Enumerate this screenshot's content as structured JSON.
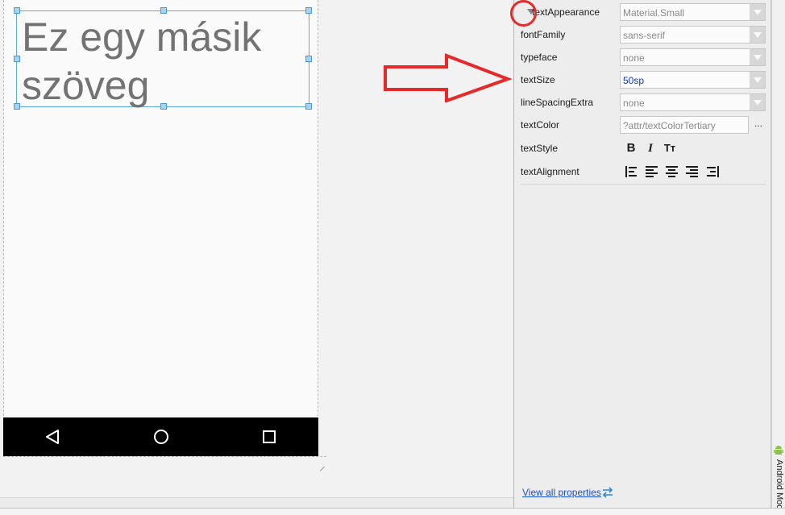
{
  "preview": {
    "text": "Ez egy másik\nszöveg"
  },
  "properties": {
    "rows": [
      {
        "label": "textAppearance",
        "value": "Material.Small",
        "kind": "dropdown"
      },
      {
        "label": "fontFamily",
        "value": "sans-serif",
        "kind": "dropdown"
      },
      {
        "label": "typeface",
        "value": "none",
        "kind": "dropdown"
      },
      {
        "label": "textSize",
        "value": "50sp",
        "kind": "dropdown"
      },
      {
        "label": "lineSpacingExtra",
        "value": "none",
        "kind": "dropdown"
      },
      {
        "label": "textColor",
        "value": "?attr/textColorTertiary",
        "kind": "text"
      },
      {
        "label": "textStyle",
        "kind": "icons"
      },
      {
        "label": "textAlignment",
        "kind": "icons"
      }
    ],
    "text_style_icons": [
      "bold-icon",
      "italic-icon",
      "all-caps-icon"
    ],
    "text_alignment_icons": [
      "align-start-icon",
      "align-left-icon",
      "align-center-icon",
      "align-right-icon",
      "align-end-icon"
    ],
    "view_all_label": "View all properties",
    "textcolor_more": "..."
  },
  "side_panel": {
    "label": "Android Mod"
  },
  "annotation_color": "#e62a2a",
  "accent_color": "#5aa9e6"
}
